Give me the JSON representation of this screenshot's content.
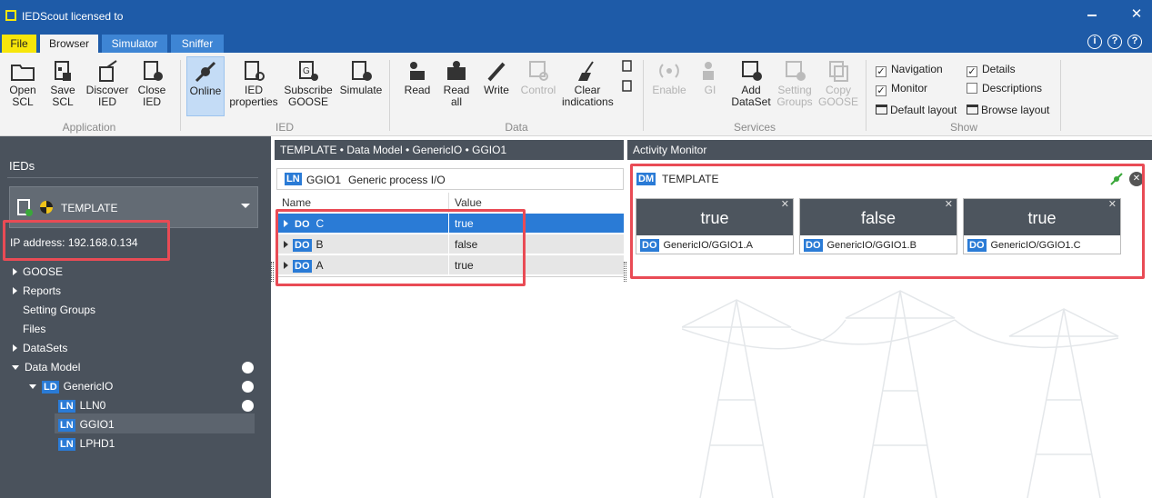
{
  "window": {
    "title": "IEDScout licensed to"
  },
  "tabs": [
    "File",
    "Browser",
    "Simulator",
    "Sniffer"
  ],
  "help_icons": [
    "info-icon",
    "feedback-icon",
    "help-icon"
  ],
  "ribbon": {
    "application": {
      "label": "Application",
      "buttons": [
        "Open SCL",
        "Save SCL",
        "Discover IED",
        "Close IED"
      ]
    },
    "ied": {
      "label": "IED",
      "buttons": [
        "Online",
        "IED properties",
        "Subscribe GOOSE",
        "Simulate"
      ]
    },
    "data": {
      "label": "Data",
      "buttons": [
        "Read",
        "Read all",
        "Write",
        "Control",
        "Clear indications"
      ]
    },
    "services": {
      "label": "Services",
      "buttons": [
        "Enable",
        "GI",
        "Add DataSet",
        "Setting Groups",
        "Copy GOOSE"
      ]
    },
    "show": {
      "label": "Show",
      "navigation": "Navigation",
      "details": "Details",
      "monitor": "Monitor",
      "descriptions": "Descriptions",
      "default_layout": "Default layout",
      "browse_layout": "Browse layout"
    }
  },
  "left_panel": {
    "header": "IEDs",
    "ied_name": "TEMPLATE",
    "ip_label": "IP address:",
    "ip_value": "192.168.0.134",
    "tree": [
      "GOOSE",
      "Reports",
      "Setting Groups",
      "Files",
      "DataSets",
      "Data Model",
      "GenericIO",
      "LLN0",
      "GGIO1",
      "LPHD1"
    ],
    "badges": {
      "ld": "LD",
      "ln": "LN"
    }
  },
  "middle_panel": {
    "breadcrumb": "TEMPLATE • Data Model • GenericIO • GGIO1",
    "ln_badge": "LN",
    "ln_name": "GGIO1",
    "ln_desc": "Generic process I/O",
    "columns": [
      "Name",
      "Value"
    ],
    "do_badge": "DO",
    "rows": [
      {
        "name": "C",
        "value": "true"
      },
      {
        "name": "B",
        "value": "false"
      },
      {
        "name": "A",
        "value": "true"
      }
    ]
  },
  "right_panel": {
    "title": "Activity Monitor",
    "dm_badge": "DM",
    "dm_name": "TEMPLATE",
    "tiles": [
      {
        "value": "true",
        "path": "GenericIO/GGIO1.A"
      },
      {
        "value": "false",
        "path": "GenericIO/GGIO1.B"
      },
      {
        "value": "true",
        "path": "GenericIO/GGIO1.C"
      }
    ]
  },
  "colors": {
    "titlebar": "#1e5ba8",
    "panel": "#4a525c",
    "selection": "#2a7bd6",
    "highlight": "#e94b55",
    "file_tab": "#f7e60a"
  }
}
